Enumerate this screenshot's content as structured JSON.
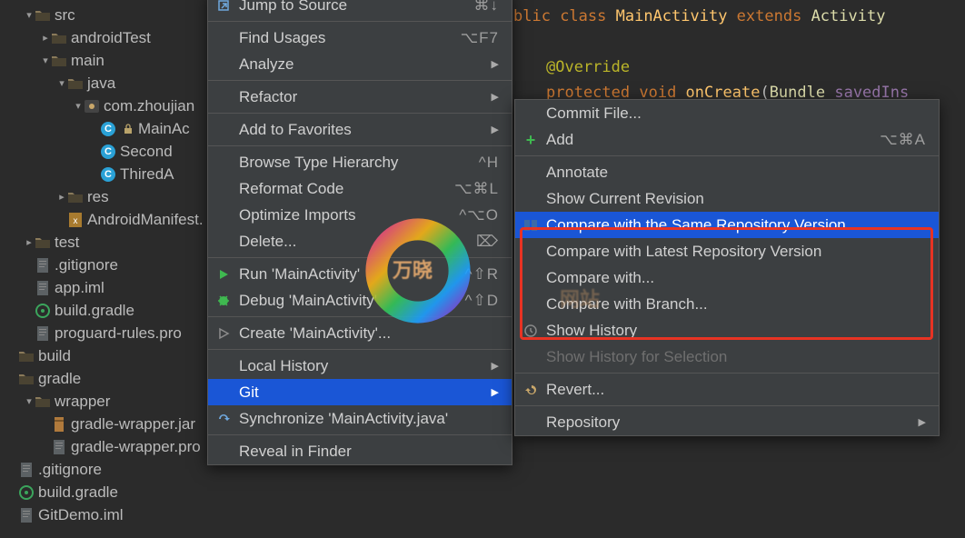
{
  "tree": [
    {
      "indent": 1,
      "arrow": "▾",
      "icon": "folder-src",
      "label": "src"
    },
    {
      "indent": 2,
      "arrow": "▸",
      "icon": "folder",
      "label": "androidTest"
    },
    {
      "indent": 2,
      "arrow": "▾",
      "icon": "folder",
      "label": "main"
    },
    {
      "indent": 3,
      "arrow": "▾",
      "icon": "folder",
      "label": "java"
    },
    {
      "indent": 4,
      "arrow": "▾",
      "icon": "package",
      "label": "com.zhoujian"
    },
    {
      "indent": 5,
      "arrow": "",
      "icon": "class",
      "label": "MainAc",
      "lock": true
    },
    {
      "indent": 5,
      "arrow": "",
      "icon": "class",
      "label": "Second"
    },
    {
      "indent": 5,
      "arrow": "",
      "icon": "class",
      "label": "ThiredA"
    },
    {
      "indent": 3,
      "arrow": "▸",
      "icon": "folder-res",
      "label": "res"
    },
    {
      "indent": 3,
      "arrow": "",
      "icon": "xml",
      "label": "AndroidManifest."
    },
    {
      "indent": 1,
      "arrow": "▸",
      "icon": "folder",
      "label": "test"
    },
    {
      "indent": 1,
      "arrow": "",
      "icon": "file",
      "label": ".gitignore"
    },
    {
      "indent": 1,
      "arrow": "",
      "icon": "file",
      "label": "app.iml"
    },
    {
      "indent": 1,
      "arrow": "",
      "icon": "gradle",
      "label": "build.gradle"
    },
    {
      "indent": 1,
      "arrow": "",
      "icon": "file",
      "label": "proguard-rules.pro"
    },
    {
      "indent": 0,
      "arrow": "",
      "icon": "folder-plain",
      "label": "build"
    },
    {
      "indent": 0,
      "arrow": "",
      "icon": "folder-plain",
      "label": "gradle"
    },
    {
      "indent": 1,
      "arrow": "▾",
      "icon": "folder",
      "label": "wrapper"
    },
    {
      "indent": 2,
      "arrow": "",
      "icon": "jar",
      "label": "gradle-wrapper.jar"
    },
    {
      "indent": 2,
      "arrow": "",
      "icon": "file-prop",
      "label": "gradle-wrapper.pro"
    },
    {
      "indent": 0,
      "arrow": "",
      "icon": "file",
      "label": ".gitignore"
    },
    {
      "indent": 0,
      "arrow": "",
      "icon": "gradle",
      "label": "build.gradle"
    },
    {
      "indent": 0,
      "arrow": "",
      "icon": "file",
      "label": "GitDemo.iml"
    }
  ],
  "code_fragment": {
    "line1_prefix": "blic ",
    "line1_class": "class ",
    "line1_name": "MainActivity ",
    "line1_extends": "extends ",
    "line1_super": "Activity ",
    "override": "@Override",
    "protected": "protected ",
    "void": "void ",
    "onCreate": "onCreate",
    "paren": "(",
    "bundle": "Bundle ",
    "arg": "savedIns"
  },
  "menu1": [
    {
      "type": "item",
      "icon": "jump",
      "label": "Jump to Source",
      "shortcut": "⌘↓"
    },
    {
      "type": "sep"
    },
    {
      "type": "item",
      "label": "Find Usages",
      "shortcut": "⌥F7"
    },
    {
      "type": "item",
      "label": "Analyze",
      "sub": true
    },
    {
      "type": "sep"
    },
    {
      "type": "item",
      "label": "Refactor",
      "sub": true
    },
    {
      "type": "sep"
    },
    {
      "type": "item",
      "label": "Add to Favorites",
      "sub": true
    },
    {
      "type": "sep"
    },
    {
      "type": "item",
      "label": "Browse Type Hierarchy",
      "shortcut": "^H"
    },
    {
      "type": "item",
      "label": "Reformat Code",
      "shortcut": "⌥⌘L"
    },
    {
      "type": "item",
      "label": "Optimize Imports",
      "shortcut": "^⌥O"
    },
    {
      "type": "item",
      "label": "Delete...",
      "shortcut": "⌦"
    },
    {
      "type": "sep"
    },
    {
      "type": "item",
      "icon": "run",
      "label": "Run 'MainActivity'",
      "shortcut": "^⇧R"
    },
    {
      "type": "item",
      "icon": "debug",
      "label": "Debug 'MainActivity'",
      "shortcut": "^⇧D"
    },
    {
      "type": "sep"
    },
    {
      "type": "item",
      "icon": "run-cfg",
      "label": "Create 'MainActivity'..."
    },
    {
      "type": "sep"
    },
    {
      "type": "item",
      "label": "Local History",
      "sub": true
    },
    {
      "type": "item",
      "label": "Git",
      "sub": true,
      "hl": true
    },
    {
      "type": "item",
      "icon": "sync",
      "label": "Synchronize 'MainActivity.java'"
    },
    {
      "type": "sep"
    },
    {
      "type": "item",
      "label": "Reveal in Finder"
    }
  ],
  "menu2": [
    {
      "type": "item",
      "label": "Commit File..."
    },
    {
      "type": "item",
      "icon": "add",
      "label": "Add",
      "shortcut": "⌥⌘A"
    },
    {
      "type": "sep"
    },
    {
      "type": "item",
      "label": "Annotate"
    },
    {
      "type": "item",
      "label": "Show Current Revision"
    },
    {
      "type": "item",
      "icon": "diff",
      "label": "Compare with the Same Repository Version",
      "hl": true
    },
    {
      "type": "item",
      "label": "Compare with Latest Repository Version"
    },
    {
      "type": "item",
      "label": "Compare with..."
    },
    {
      "type": "item",
      "label": "Compare with Branch..."
    },
    {
      "type": "item",
      "icon": "history",
      "label": "Show History"
    },
    {
      "type": "item",
      "label": "Show History for Selection",
      "disabled": true
    },
    {
      "type": "sep"
    },
    {
      "type": "item",
      "icon": "revert",
      "label": "Revert..."
    },
    {
      "type": "sep"
    },
    {
      "type": "item",
      "label": "Repository",
      "sub": true
    }
  ],
  "watermark": {
    "text": "万晓",
    "sub": "网站"
  }
}
